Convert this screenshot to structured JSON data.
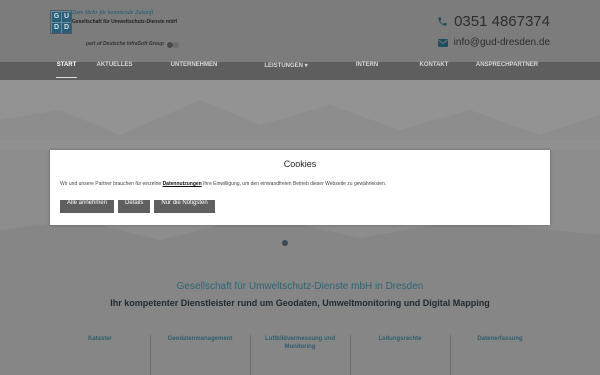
{
  "header": {
    "logo": {
      "mark_letters": [
        "G",
        "U",
        "D",
        "D"
      ],
      "tagline": "Dem Mehr für kommende Zukunft",
      "company": "Gesellschaft für Umweltschutz-Dienste mbH",
      "group": "part of Deutsche InfraSoft Group"
    },
    "phone": "0351 4867374",
    "email": "info@gud-dresden.de"
  },
  "nav": {
    "items": [
      {
        "label": "Start",
        "active": true
      },
      {
        "label": "Aktuelles"
      },
      {
        "label": "Unternehmen"
      },
      {
        "label": "Leistungen ▾"
      },
      {
        "label": "Intern"
      },
      {
        "label": "Kontakt"
      },
      {
        "label": "Ansprechpartner"
      }
    ]
  },
  "cookie": {
    "title": "Cookies",
    "text_before": "Wir und unsere Partner brauchen für einzelne",
    "link": "Datennutzungen",
    "text_after": "Ihre Einwilligung, um den einwandfreien Betrieb dieser Webseite zu gewährleisten.",
    "buttons": [
      "Alle annehmen",
      "Details",
      "Nur die Nötigsten"
    ]
  },
  "main": {
    "headline": "Gesellschaft für Umweltschutz-Dienste mbH in Dresden",
    "subheadline": "Ihr kompetenter Dienstleister rund um Geodaten, Umweltmonitoring und Digital Mapping",
    "features": [
      "Kataster",
      "Geodatenmanagement",
      "Luftbildvermessung und Monitoring",
      "Leitungsrechte",
      "Datenerfassung"
    ]
  },
  "colors": {
    "accent": "#2f6374",
    "nav_bg": "#5e5e5e",
    "button_bg": "#5f5f5f"
  }
}
